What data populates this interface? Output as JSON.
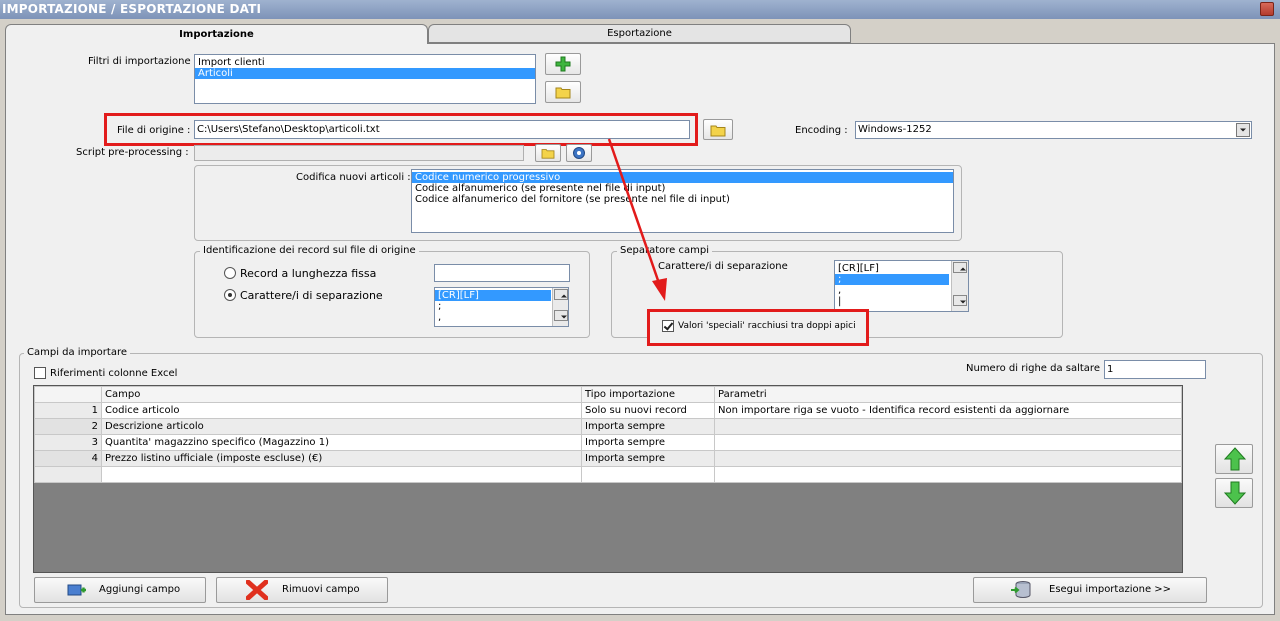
{
  "window": {
    "title": "IMPORTAZIONE / ESPORTAZIONE DATI"
  },
  "tabs": [
    {
      "label": "Importazione",
      "active": true
    },
    {
      "label": "Esportazione",
      "active": false
    }
  ],
  "filters": {
    "label": "Filtri di importazione :",
    "items": [
      "Import clienti",
      "Articoli"
    ],
    "selected": "Articoli"
  },
  "source": {
    "file_label": "File di origine :",
    "file_value": "C:\\Users\\Stefano\\Desktop\\articoli.txt",
    "script_label": "Script pre-processing :",
    "script_value": "",
    "encoding_label": "Encoding :",
    "encoding_value": "Windows-1252"
  },
  "coding": {
    "label": "Codifica nuovi articoli :",
    "options": [
      "Codice numerico progressivo",
      "Codice alfanumerico (se presente nel file di input)",
      "Codice alfanumerico del fornitore (se presente nel file di input)"
    ],
    "selected": "Codice numerico progressivo"
  },
  "record_id": {
    "title": "Identificazione dei record sul file di origine",
    "fixed_label": "Record a lunghezza fissa",
    "sep_label": "Carattere/i di separazione",
    "selected": "sep",
    "separators": [
      "[CR][LF]",
      ";",
      ","
    ],
    "sep_selected": "[CR][LF]"
  },
  "field_sep": {
    "title": "Separatore campi",
    "label": "Carattere/i di separazione",
    "options": [
      "[CR][LF]",
      ";",
      ",",
      "|"
    ],
    "selected": ";",
    "quote_label": "Valori 'speciali' racchiusi tra doppi apici",
    "quote_checked": true
  },
  "fields": {
    "title": "Campi da importare",
    "excel_label": "Riferimenti colonne Excel",
    "excel_checked": false,
    "skip_label": "Numero di righe da saltare :",
    "skip_value": "1",
    "columns": [
      "Campo",
      "Tipo importazione",
      "Parametri"
    ],
    "rows": [
      {
        "n": "1",
        "campo": "Codice articolo",
        "tipo": "Solo su nuovi record",
        "parametri": "Non importare riga se vuoto - Identifica record esistenti da aggiornare"
      },
      {
        "n": "2",
        "campo": "Descrizione articolo",
        "tipo": "Importa sempre",
        "parametri": ""
      },
      {
        "n": "3",
        "campo": "Quantita' magazzino specifico (Magazzino 1)",
        "tipo": "Importa sempre",
        "parametri": ""
      },
      {
        "n": "4",
        "campo": "Prezzo listino ufficiale (imposte escluse) (€)",
        "tipo": "Importa sempre",
        "parametri": ""
      }
    ]
  },
  "actions": {
    "add": "Aggiungi campo",
    "remove": "Rimuovi campo",
    "run": "Esegui importazione >>"
  },
  "colors": {
    "highlight": "#e21b1b",
    "selection": "#3399ff",
    "arrow_up": "#3aa83a"
  }
}
